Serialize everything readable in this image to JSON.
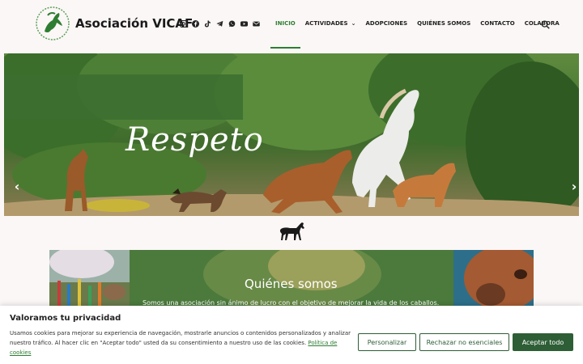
{
  "header": {
    "site_title": "Asociación VICAF",
    "social_icons": [
      "instagram-icon",
      "facebook-icon",
      "tiktok-icon",
      "telegram-icon",
      "whatsapp-icon",
      "youtube-icon",
      "email-icon"
    ],
    "nav": [
      {
        "label": "INICIO",
        "active": true
      },
      {
        "label": "ACTIVIDADES",
        "has_dropdown": true
      },
      {
        "label": "ADOPCIONES"
      },
      {
        "label": "QUIÉNES SOMOS"
      },
      {
        "label": "CONTACTO"
      },
      {
        "label": "COLABORA"
      }
    ],
    "accent_color": "#2e7d32"
  },
  "hero": {
    "word": "Respeto",
    "prev_icon": "chevron-left-icon",
    "next_icon": "chevron-right-icon"
  },
  "about": {
    "title": "Quiénes somos",
    "text": "Somos una asociación sin ánimo de lucro con el objetivo de mejorar la vida de los caballos."
  },
  "cookie": {
    "title": "Valoramos tu privacidad",
    "text": "Usamos cookies para mejorar su experiencia de navegación, mostrarle anuncios o contenidos personalizados y analizar nuestro tráfico. Al hacer clic en \"Aceptar todo\" usted da su consentimiento a nuestro uso de las cookies.",
    "link": "Política de cookies",
    "buttons": {
      "customize": "Personalizar",
      "reject": "Rechazar no esenciales",
      "accept": "Aceptar todo"
    },
    "button_color": "#2e5e36"
  }
}
